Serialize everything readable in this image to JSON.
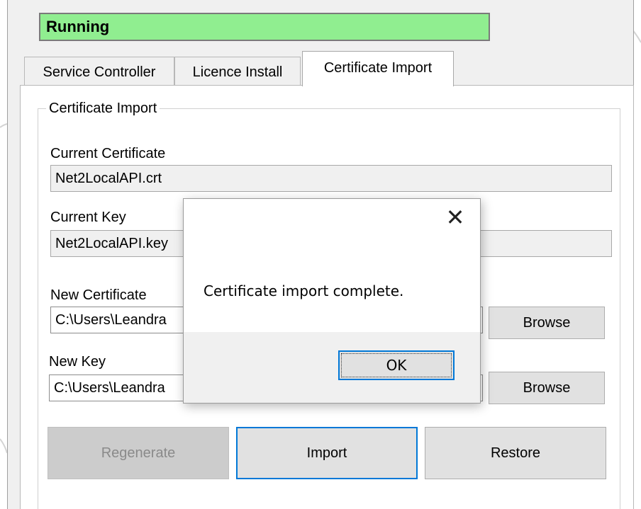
{
  "status": {
    "text": "Running",
    "color": "#90ee90"
  },
  "tabs": [
    {
      "label": "Service Controller",
      "selected": false
    },
    {
      "label": "Licence Install",
      "selected": false
    },
    {
      "label": "Certificate Import",
      "selected": true
    }
  ],
  "certificate_import": {
    "group_title": "Certificate Import",
    "current_certificate": {
      "label": "Current Certificate",
      "value": "Net2LocalAPI.crt"
    },
    "current_key": {
      "label": "Current Key",
      "value": "Net2LocalAPI.key"
    },
    "new_certificate": {
      "label": "New Certificate",
      "value": "C:\\Users\\Leandra",
      "browse_label": "Browse"
    },
    "new_key": {
      "label": "New Key",
      "value": "C:\\Users\\Leandra",
      "browse_label": "Browse"
    },
    "buttons": {
      "regenerate": "Regenerate",
      "import": "Import",
      "restore": "Restore"
    }
  },
  "dialog": {
    "close_icon": "close-icon",
    "message": "Certificate import complete.",
    "ok_label": "OK"
  },
  "colors": {
    "accent": "#0078d7",
    "status_green": "#90ee90"
  }
}
